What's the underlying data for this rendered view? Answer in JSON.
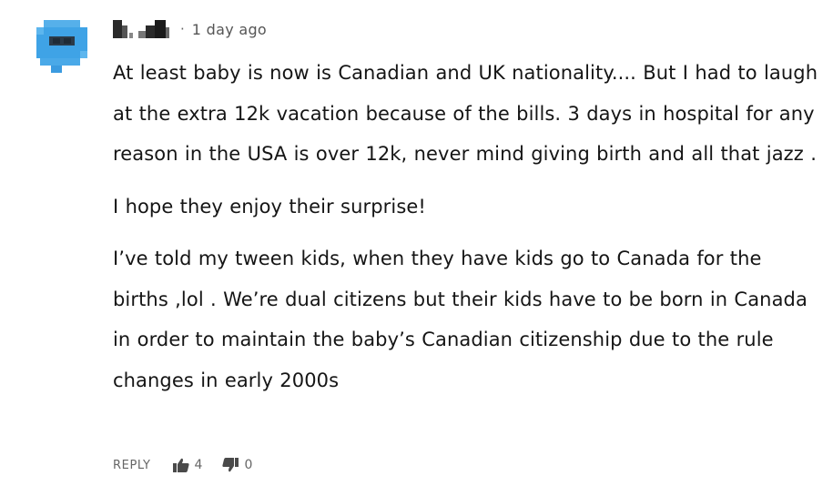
{
  "comment": {
    "author_avatar": "pixelated-avatar",
    "author_name_redacted": true,
    "separator": "·",
    "timestamp": "1 day ago",
    "paragraphs": [
      "At least baby is now is Canadian and UK nationality.... But I had to laugh at the extra 12k vacation because of the bills. 3 days in hospital for any reason in the USA is over 12k, never mind giving birth and all that jazz .",
      "I hope they enjoy their surprise!",
      "I’ve told my tween kids, when they have kids go to Canada for the births ,lol . We’re dual citizens but their kids have to be born in Canada in order to maintain the baby’s Canadian citizenship due to the rule changes in early 2000s"
    ],
    "actions": {
      "reply_label": "REPLY",
      "upvote_icon": "thumbs-up-icon",
      "upvote_count": "4",
      "downvote_icon": "thumbs-down-icon",
      "downvote_count": "0"
    }
  },
  "colors": {
    "avatar_blue": "#3fa3e6",
    "avatar_dark": "#2b3a48",
    "text": "#151515",
    "muted": "#666666"
  }
}
